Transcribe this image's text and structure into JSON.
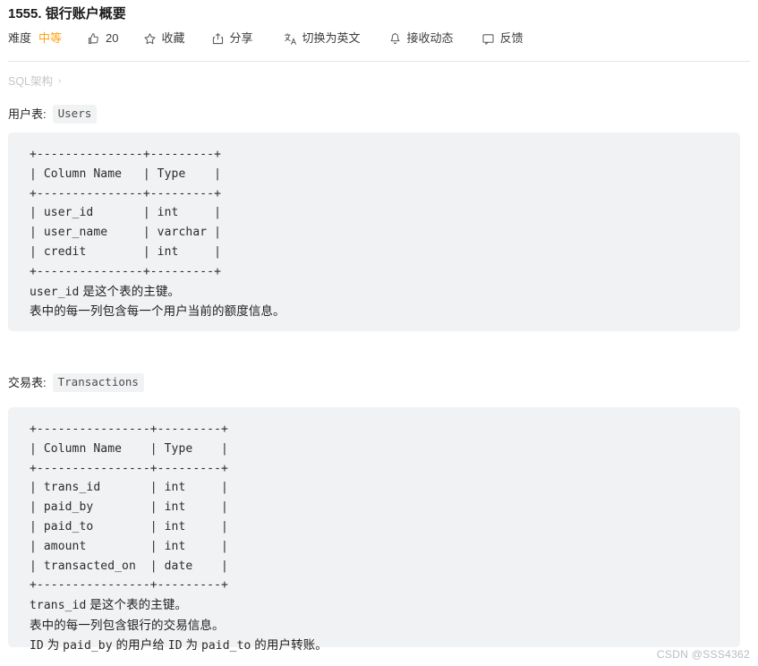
{
  "header": {
    "title": "1555. 银行账户概要"
  },
  "toolbar": {
    "difficulty_label": "难度",
    "difficulty_value": "中等",
    "difficulty_color": "#ffa116",
    "like_count": "20",
    "favorite_label": "收藏",
    "share_label": "分享",
    "translate_label": "切换为英文",
    "subscribe_label": "接收动态",
    "feedback_label": "反馈",
    "icons": {
      "like": "thumbs-up-icon",
      "favorite": "star-icon",
      "share": "share-icon",
      "translate": "translate-icon",
      "subscribe": "bell-icon",
      "feedback": "comment-icon"
    }
  },
  "schema_toggle": {
    "label": "SQL架构",
    "chevron": "›"
  },
  "sections": [
    {
      "heading_label": "用户表:",
      "heading_code": "Users",
      "code_lines": [
        "+---------------+---------+",
        "| Column Name   | Type    |",
        "+---------------+---------+",
        "| user_id       | int     |",
        "| user_name     | varchar |",
        "| credit        | int     |",
        "+---------------+---------+"
      ],
      "notes": [
        {
          "parts": [
            {
              "t": "user_id",
              "mono": true
            },
            {
              "t": " 是这个表的主键。",
              "mono": false
            }
          ]
        },
        {
          "parts": [
            {
              "t": "表中的每一列包含每一个用户当前的额度信息。",
              "mono": false
            }
          ]
        }
      ]
    },
    {
      "heading_label": "交易表:",
      "heading_code": "Transactions",
      "code_lines": [
        "+----------------+---------+",
        "| Column Name    | Type    |",
        "+----------------+---------+",
        "| trans_id       | int     |",
        "| paid_by        | int     |",
        "| paid_to        | int     |",
        "| amount         | int     |",
        "| transacted_on  | date    |",
        "+----------------+---------+"
      ],
      "notes": [
        {
          "parts": [
            {
              "t": "trans_id",
              "mono": true
            },
            {
              "t": " 是这个表的主键。",
              "mono": false
            }
          ]
        },
        {
          "parts": [
            {
              "t": "表中的每一列包含银行的交易信息。",
              "mono": false
            }
          ]
        },
        {
          "parts": [
            {
              "t": "ID",
              "mono": true
            },
            {
              "t": " 为 ",
              "mono": false
            },
            {
              "t": "paid_by",
              "mono": true
            },
            {
              "t": " 的用户给 ",
              "mono": false
            },
            {
              "t": "ID",
              "mono": true
            },
            {
              "t": " 为 ",
              "mono": false
            },
            {
              "t": "paid_to",
              "mono": true
            },
            {
              "t": " 的用户转账。",
              "mono": false
            }
          ]
        }
      ]
    }
  ],
  "watermark": "CSDN @SSS4362"
}
